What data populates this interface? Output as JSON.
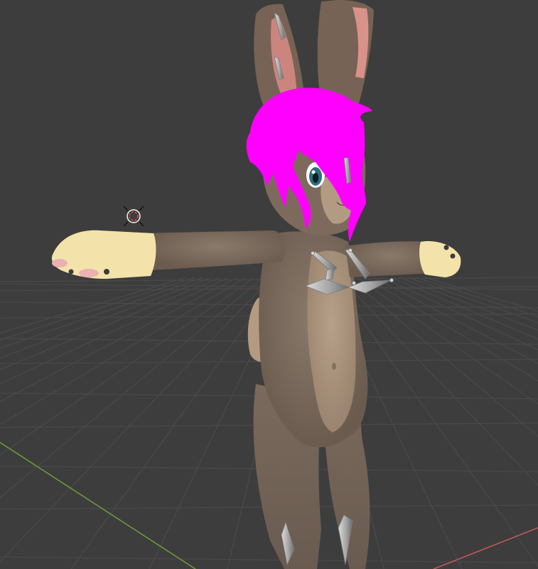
{
  "viewport": {
    "background_color": "#3d3d3d",
    "grid_color": "#4a4a4a",
    "x_axis_color": "#c05858",
    "y_axis_color": "#6a9a3a"
  },
  "scene": {
    "character": {
      "fur_color": "#7a6a5d",
      "belly_color": "#a8927c",
      "paw_color": "#f3e3aa",
      "hair_color": "#ff00ff",
      "inner_ear_color": "#d38d86",
      "eye_color": "#2d6f7f"
    },
    "armature_color": "#a8a8a8",
    "icons": [
      "light-icon"
    ]
  }
}
